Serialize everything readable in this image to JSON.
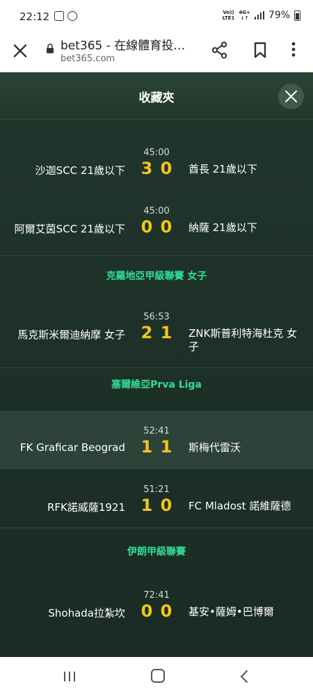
{
  "status_bar": {
    "time": "22:12",
    "network": "Vo)) 4G+ LTE1",
    "battery": "79%"
  },
  "browser": {
    "title": "bet365 - 在線體育投…",
    "url": "bet365.com"
  },
  "panel": {
    "title": "收藏夾"
  },
  "sections": [
    {
      "league": "",
      "matches": [
        {
          "time": "45:00",
          "home": "沙迦SCC 21歲以下",
          "home_score": "3",
          "away_score": "0",
          "away": "酋長 21歲以下"
        },
        {
          "time": "45:00",
          "home": "阿爾艾茵SCC 21歲以下",
          "home_score": "0",
          "away_score": "0",
          "away": "納薩 21歲以下"
        }
      ]
    },
    {
      "league": "克羅地亞甲級聯賽 女子",
      "matches": [
        {
          "time": "56:53",
          "home": "馬克斯米爾迪納摩 女子",
          "home_score": "2",
          "away_score": "1",
          "away": "ZNK斯普利特海杜克 女子"
        }
      ]
    },
    {
      "league": "塞爾維亞Prva Liga",
      "matches": [
        {
          "time": "52:41",
          "home": "FK Graficar Beograd",
          "home_score": "1",
          "away_score": "1",
          "away": "斯梅代雷沃"
        },
        {
          "time": "51:21",
          "home": "RFK諾威薩1921",
          "home_score": "1",
          "away_score": "0",
          "away": "FC Mladost 諾維薩德"
        }
      ]
    },
    {
      "league": "伊朗甲級聯賽",
      "matches": [
        {
          "time": "72:41",
          "home": "Shohada拉紮坎",
          "home_score": "0",
          "away_score": "0",
          "away": "基安•薩姆•巴博爾"
        }
      ]
    }
  ],
  "colors": {
    "score": "#f5c518",
    "league": "#2fdf9a",
    "background": "#1b2c25"
  }
}
